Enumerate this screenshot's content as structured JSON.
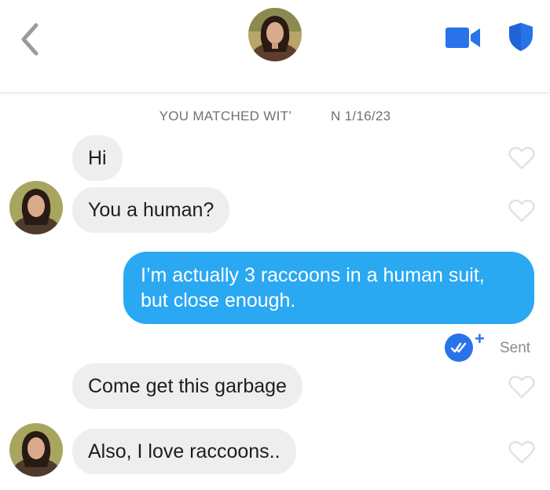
{
  "header": {
    "back_icon": "chevron-left-icon",
    "video_icon": "video-camera-icon",
    "safety_icon": "shield-icon",
    "accent_color": "#2873ea"
  },
  "match_banner": "YOU MATCHED WIT’          N 1/16/23",
  "messages": [
    {
      "from": "them",
      "text": "Hi"
    },
    {
      "from": "them",
      "text": "You a human?"
    },
    {
      "from": "me",
      "lines": [
        "I’m actually 3 raccoons in a human suit,",
        "but close enough."
      ]
    },
    {
      "from": "them",
      "text": "Come get this garbage"
    },
    {
      "from": "them",
      "text": "Also, I love raccoons.."
    }
  ],
  "status": {
    "label": "Sent",
    "plus": "+"
  },
  "colors": {
    "sent_bubble": "#2aa8f2",
    "received_bubble": "#eeeeef",
    "read_badge": "#2873ea"
  }
}
